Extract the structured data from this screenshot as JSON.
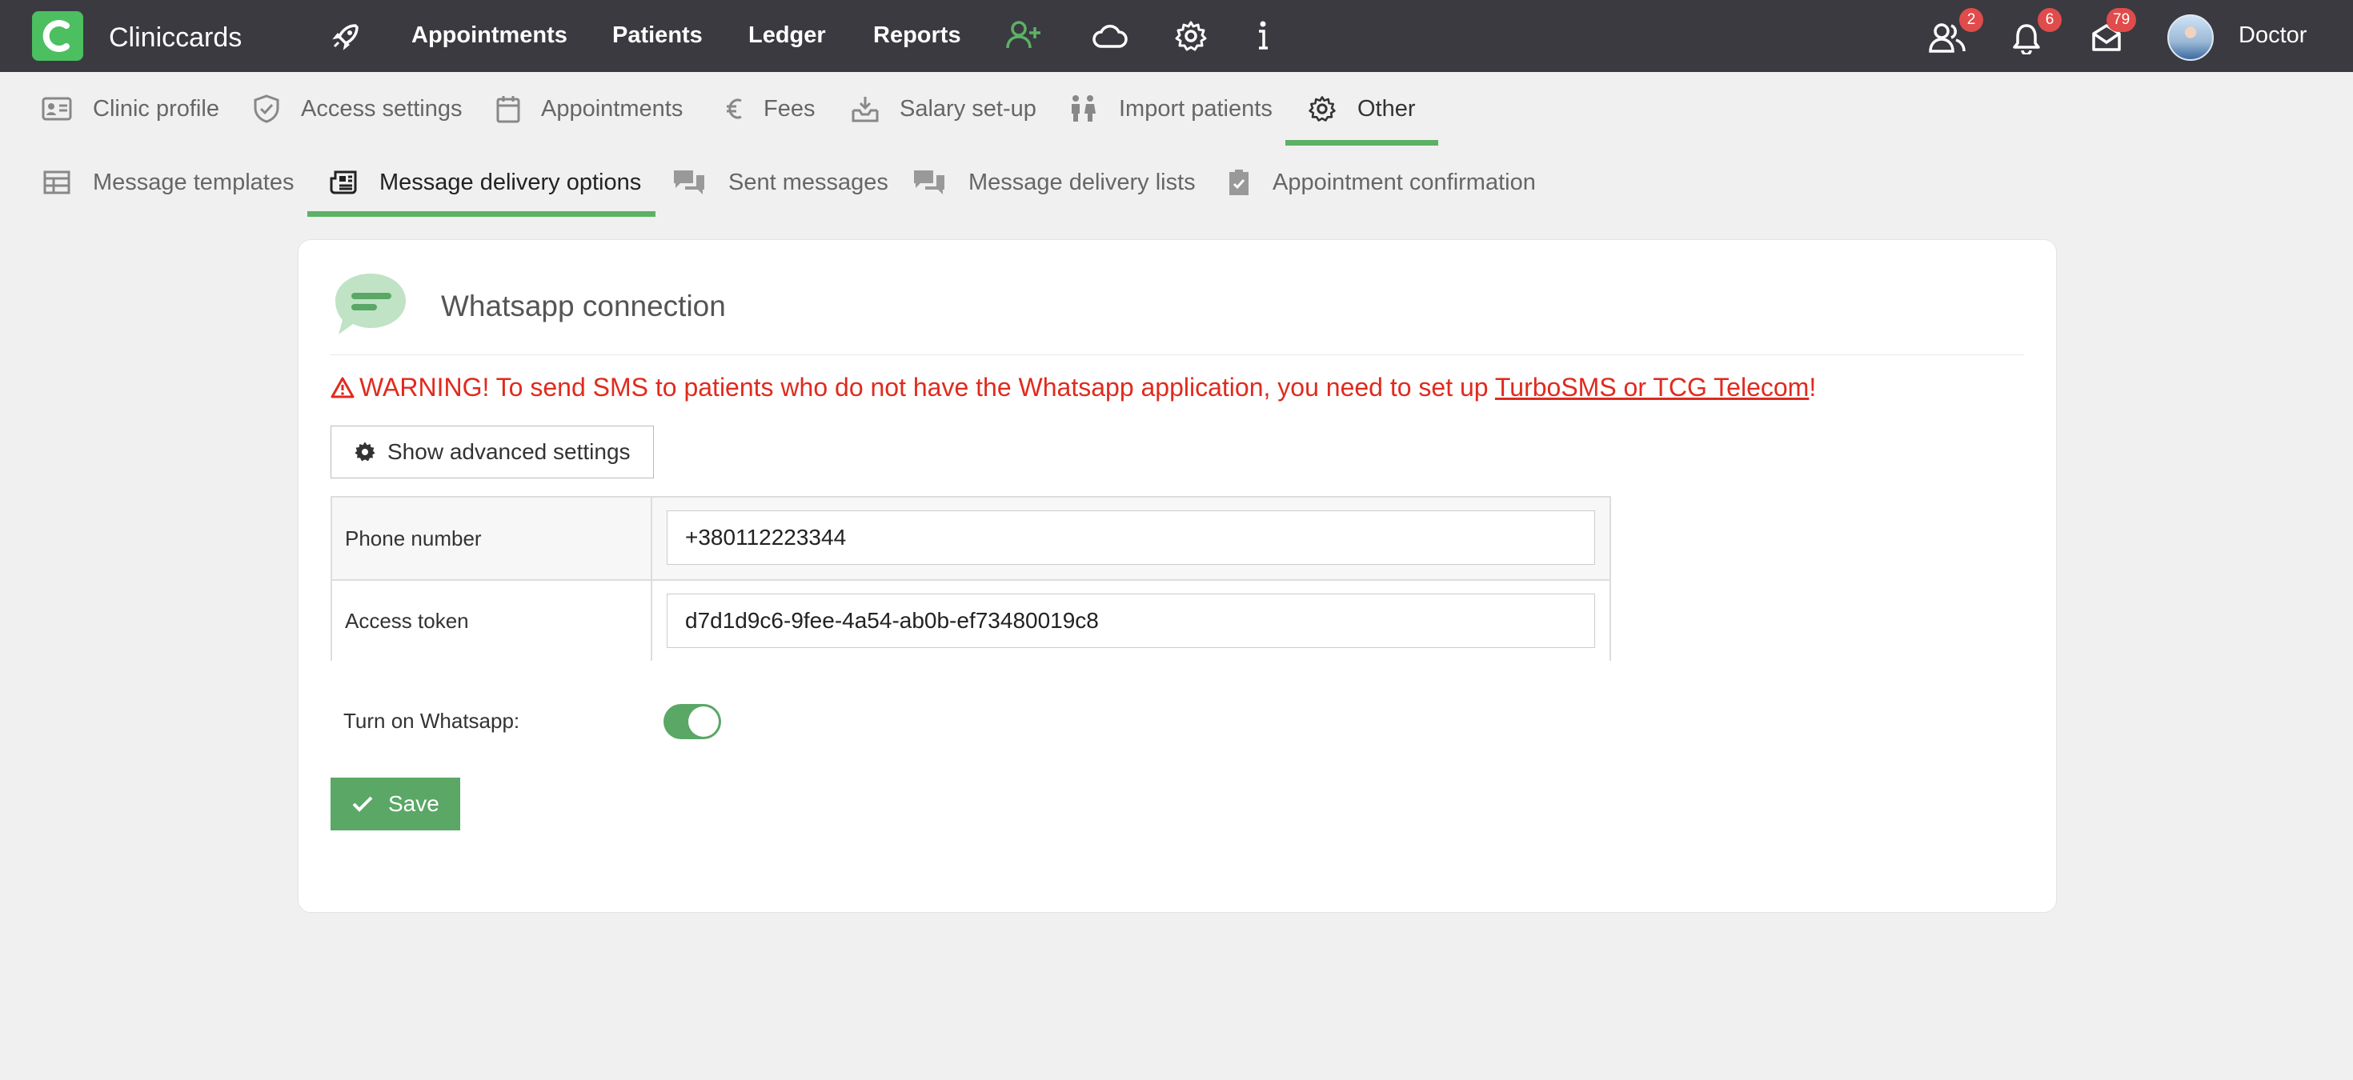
{
  "app": {
    "brand": "Cliniccards",
    "logo_letter": "C"
  },
  "top_nav": {
    "items": [
      {
        "icon": "rocket-icon"
      },
      {
        "label": "Appointments"
      },
      {
        "label": "Patients"
      },
      {
        "label": "Ledger"
      },
      {
        "label": "Reports"
      },
      {
        "icon": "add-user-icon"
      },
      {
        "icon": "cloud-icon"
      },
      {
        "icon": "gear-icon"
      },
      {
        "icon": "info-icon"
      }
    ],
    "right": {
      "users_badge": "2",
      "notifications_badge": "6",
      "messages_badge": "79",
      "user_name": "Doctor"
    }
  },
  "settings_tabs": [
    {
      "label": "Clinic profile",
      "icon": "id-card-icon"
    },
    {
      "label": "Access settings",
      "icon": "shield-check-icon"
    },
    {
      "label": "Appointments",
      "icon": "calendar-icon"
    },
    {
      "label": "Fees",
      "icon": "euro-icon"
    },
    {
      "label": "Salary set-up",
      "icon": "money-tray-icon"
    },
    {
      "label": "Import patients",
      "icon": "people-icon"
    },
    {
      "label": "Other",
      "icon": "gear-icon",
      "active": true
    }
  ],
  "sub_tabs": [
    {
      "label": "Message templates",
      "icon": "table-icon"
    },
    {
      "label": "Message delivery options",
      "icon": "newspaper-icon",
      "active": true
    },
    {
      "label": "Sent messages",
      "icon": "chat-bubbles-icon"
    },
    {
      "label": "Message delivery lists",
      "icon": "chat-bubbles-icon"
    },
    {
      "label": "Appointment confirmation",
      "icon": "clipboard-check-icon"
    }
  ],
  "card": {
    "title": "Whatsapp connection",
    "warning": {
      "prefix": "WARNING! To send SMS to patients who do not have the Whatsapp application, you need to set up ",
      "link": "TurboSMS or TCG Telecom",
      "suffix": "!"
    },
    "advanced_button": "Show advanced settings",
    "fields": [
      {
        "label": "Phone number",
        "value": "+380112223344"
      },
      {
        "label": "Access token",
        "value": "d7d1d9c6-9fee-4a54-ab0b-ef73480019c8"
      }
    ],
    "toggle_label": "Turn on Whatsapp:",
    "toggle_on": true,
    "save_button": "Save"
  },
  "colors": {
    "accent": "#5cb165",
    "topbar": "#3a3a40",
    "warning": "#e02a1e",
    "badge": "#e04b4b"
  }
}
